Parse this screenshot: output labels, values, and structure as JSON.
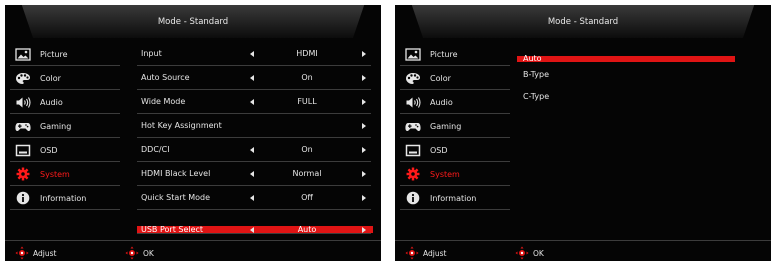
{
  "left_panel": {
    "title": "Mode - Standard",
    "sidebar": [
      {
        "label": "Picture",
        "icon": "picture-icon",
        "active": false
      },
      {
        "label": "Color",
        "icon": "palette-icon",
        "active": false
      },
      {
        "label": "Audio",
        "icon": "speaker-icon",
        "active": false
      },
      {
        "label": "Gaming",
        "icon": "gamepad-icon",
        "active": false
      },
      {
        "label": "OSD",
        "icon": "osd-icon",
        "active": false
      },
      {
        "label": "System",
        "icon": "gear-icon",
        "active": true
      },
      {
        "label": "Information",
        "icon": "info-icon",
        "active": false
      }
    ],
    "settings": [
      {
        "label": "Input",
        "value": "HDMI",
        "left_arrow": true,
        "right_arrow": true
      },
      {
        "label": "Auto Source",
        "value": "On",
        "left_arrow": true,
        "right_arrow": true
      },
      {
        "label": "Wide Mode",
        "value": "FULL",
        "left_arrow": true,
        "right_arrow": true
      },
      {
        "label": "Hot Key Assignment",
        "value": "",
        "left_arrow": false,
        "right_arrow": true
      },
      {
        "label": "DDC/CI",
        "value": "On",
        "left_arrow": true,
        "right_arrow": true
      },
      {
        "label": "HDMI Black Level",
        "value": "Normal",
        "left_arrow": true,
        "right_arrow": true
      },
      {
        "label": "Quick Start Mode",
        "value": "Off",
        "left_arrow": true,
        "right_arrow": true
      },
      {
        "label": "USB Port Select",
        "value": "Auto",
        "left_arrow": true,
        "right_arrow": true,
        "selected": true
      }
    ],
    "footer": {
      "adjust_label": "Adjust",
      "ok_label": "OK"
    }
  },
  "right_panel": {
    "title": "Mode - Standard",
    "sidebar": [
      {
        "label": "Picture",
        "icon": "picture-icon",
        "active": false
      },
      {
        "label": "Color",
        "icon": "palette-icon",
        "active": false
      },
      {
        "label": "Audio",
        "icon": "speaker-icon",
        "active": false
      },
      {
        "label": "Gaming",
        "icon": "gamepad-icon",
        "active": false
      },
      {
        "label": "OSD",
        "icon": "osd-icon",
        "active": false
      },
      {
        "label": "System",
        "icon": "gear-icon",
        "active": true
      },
      {
        "label": "Information",
        "icon": "info-icon",
        "active": false
      }
    ],
    "options": [
      {
        "label": "Auto",
        "selected": true
      },
      {
        "label": "B-Type",
        "selected": false
      },
      {
        "label": "C-Type",
        "selected": false
      }
    ],
    "footer": {
      "adjust_label": "Adjust",
      "ok_label": "OK"
    }
  },
  "colors": {
    "background": "#050505",
    "accent": "#e01414",
    "text": "#e6e6e6",
    "divider": "#3c3c3c"
  }
}
